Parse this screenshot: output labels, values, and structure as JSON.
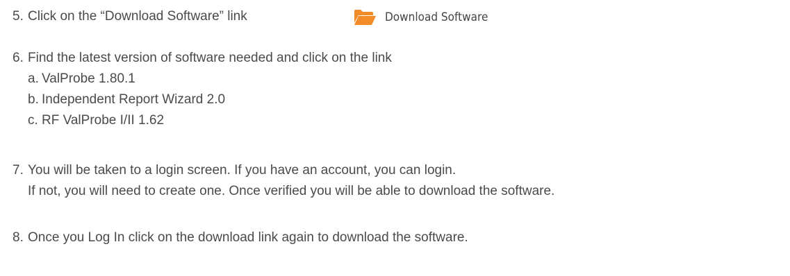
{
  "colors": {
    "text": "#4a4a4a",
    "folder_icon": "#f28c28"
  },
  "steps": [
    {
      "number": "5.",
      "lines": [
        "Click on the “Download Software” link"
      ]
    },
    {
      "number": "6.",
      "lines": [
        "Find the latest version of software needed and click on the link"
      ],
      "subitems": [
        {
          "letter": "a.",
          "text": "ValProbe 1.80.1"
        },
        {
          "letter": "b.",
          "text": "Independent Report Wizard 2.0"
        },
        {
          "letter": "c.",
          "text": "RF ValProbe I/II 1.62"
        }
      ]
    },
    {
      "number": "7.",
      "lines": [
        "You will be taken to a login screen. If you have an account, you can login.",
        "If not, you will need to create one. Once verified you will be able to download the software."
      ]
    },
    {
      "number": "8.",
      "lines": [
        "Once you Log In click on the download link again to download the software."
      ]
    }
  ],
  "download_link": {
    "icon": "folder-open-icon",
    "label": "Download Software"
  }
}
